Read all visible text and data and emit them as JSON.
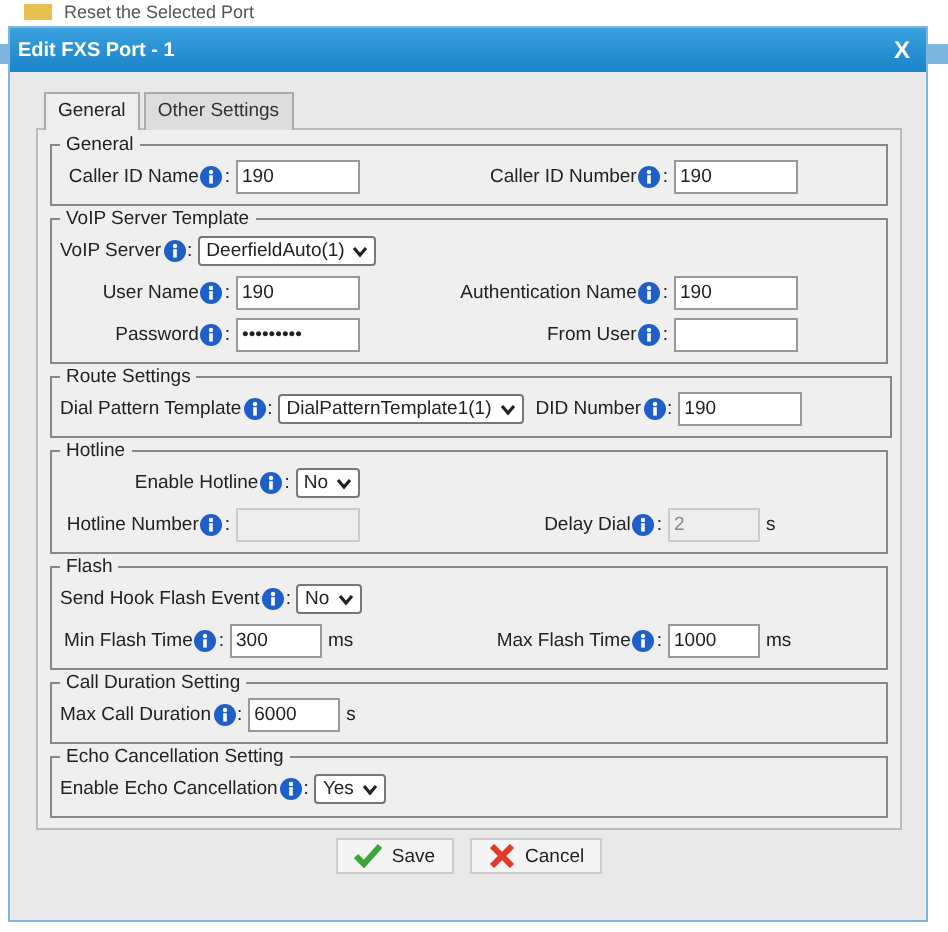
{
  "background": {
    "link": "Reset the Selected Port"
  },
  "dialog": {
    "title": "Edit FXS Port - 1",
    "close": "X"
  },
  "tabs": [
    {
      "label": "General",
      "selected": true
    },
    {
      "label": "Other Settings",
      "selected": false
    }
  ],
  "sections": [
    {
      "legend": "General",
      "rows": [
        [
          {
            "label": "Caller ID Name",
            "sep": ":",
            "kind": "text",
            "value": "190"
          },
          {
            "label": "Caller ID Number",
            "sep": ":",
            "kind": "text",
            "value": "190"
          }
        ]
      ]
    },
    {
      "legend": "VoIP Server Template",
      "rows": [
        [
          {
            "label": "VoIP Server",
            "sep": ":",
            "kind": "select",
            "value": "DeerfieldAuto(1)"
          }
        ],
        [
          {
            "label": "User Name",
            "sep": ":",
            "kind": "text",
            "value": "190"
          },
          {
            "label": "Authentication Name",
            "sep": ":",
            "kind": "text",
            "value": "190"
          }
        ],
        [
          {
            "label": "Password",
            "sep": ":",
            "kind": "text",
            "value": "•••••••••"
          },
          {
            "label": "From User",
            "sep": ":",
            "kind": "text"
          }
        ]
      ]
    },
    {
      "legend": "Route Settings",
      "rows": [
        [
          {
            "label": "Dial Pattern Template",
            "sep": ":",
            "kind": "select",
            "value": "DialPatternTemplate1(1)"
          },
          {
            "label": "DID Number",
            "sep": ":",
            "kind": "text",
            "value": "190"
          }
        ]
      ]
    },
    {
      "legend": "Hotline",
      "rows": [
        [
          {
            "label": "Enable Hotline",
            "sep": ":",
            "kind": "select",
            "value": "No"
          }
        ],
        [
          {
            "label": "Hotline Number",
            "sep": ":",
            "kind": "text",
            "disabled": true
          },
          {
            "label": "Delay Dial",
            "sep": ":",
            "kind": "text",
            "value": "2",
            "unit": "s",
            "disabled": true
          }
        ]
      ]
    },
    {
      "legend": "Flash",
      "rows": [
        [
          {
            "label": "Send Hook Flash Event",
            "sep": ":",
            "kind": "select",
            "value": "No"
          }
        ],
        [
          {
            "label": "Min Flash Time",
            "sep": ":",
            "kind": "text",
            "value": "300",
            "unit": "ms"
          },
          {
            "label": "Max Flash Time",
            "sep": ":",
            "kind": "text",
            "value": "1000",
            "unit": "ms"
          }
        ]
      ]
    },
    {
      "legend": "Call Duration Setting",
      "rows": [
        [
          {
            "label": "Max Call Duration",
            "sep": ":",
            "kind": "text",
            "value": "6000",
            "unit": "s"
          }
        ]
      ]
    },
    {
      "legend": "Echo Cancellation Setting",
      "rows": [
        [
          {
            "label": "Enable Echo Cancellation",
            "sep": ":",
            "kind": "select",
            "value": "Yes"
          }
        ]
      ]
    }
  ],
  "buttons": [
    {
      "label": "Save",
      "kind": "save"
    },
    {
      "label": "Cancel",
      "kind": "cancel"
    }
  ]
}
